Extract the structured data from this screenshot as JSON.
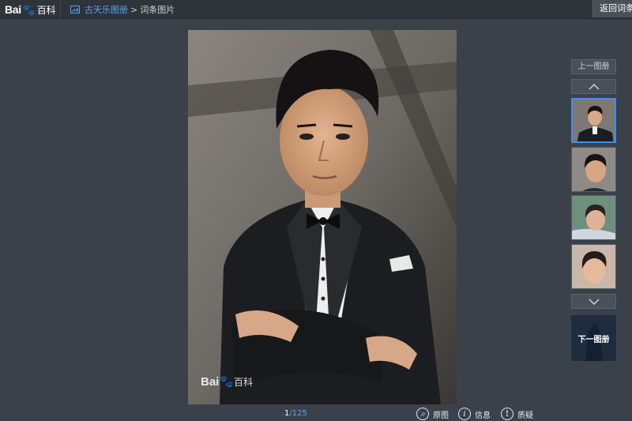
{
  "header": {
    "logo_text": "Bai",
    "logo_suffix": "百科",
    "album_title": "古天乐图册",
    "separator": ">",
    "current_page": "词条图片",
    "back_button": "返回词条"
  },
  "photo": {
    "watermark_text": "Bai",
    "watermark_suffix": "百科"
  },
  "footer": {
    "current_index": "1",
    "total": "/125",
    "tools": [
      {
        "label": "原图",
        "icon": "magnifier-icon"
      },
      {
        "label": "信息",
        "icon": "info-icon"
      },
      {
        "label": "质疑",
        "icon": "exclamation-icon"
      }
    ]
  },
  "sidebar": {
    "prev_album": "上一图册",
    "next_album": "下一图册",
    "thumbnails_count": 4
  },
  "colors": {
    "accent": "#3a8ef6",
    "link": "#5aa0f0",
    "background": "#3b4149",
    "topbar": "#2f343a"
  }
}
